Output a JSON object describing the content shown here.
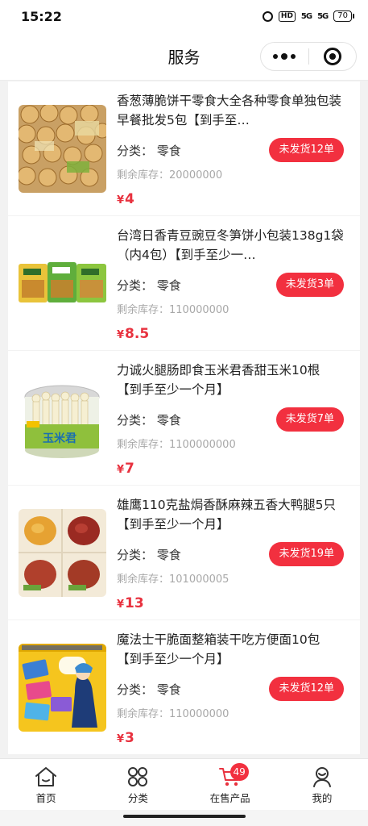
{
  "status_bar": {
    "time": "15:22",
    "hd": "HD",
    "sig1": "5G",
    "sig2": "5G",
    "battery": "70"
  },
  "nav": {
    "title": "服务"
  },
  "products": [
    {
      "title": "香葱薄脆饼干零食大全各种零食单独包装早餐批发5包【到手至…",
      "category": "分类：  零食",
      "stock": "剩余库存：20000000",
      "currency": "¥",
      "price": "4",
      "badge": "未发货12单"
    },
    {
      "title": "台湾日香青豆豌豆冬笋饼小包装138g1袋（内4包）【到手至少一…",
      "category": "分类：  零食",
      "stock": "剩余库存：110000000",
      "currency": "¥",
      "price": "8.5",
      "badge": "未发货3单"
    },
    {
      "title": "力诚火腿肠即食玉米君香甜玉米10根【到手至少一个月】",
      "category": "分类：  零食",
      "stock": "剩余库存：1100000000",
      "currency": "¥",
      "price": "7",
      "badge": "未发货7单"
    },
    {
      "title": "雄鹰110克盐焗香酥麻辣五香大鸭腿5只【到手至少一个月】",
      "category": "分类：  零食",
      "stock": "剩余库存：101000005",
      "currency": "¥",
      "price": "13",
      "badge": "未发货19单"
    },
    {
      "title": "魔法士干脆面整箱装干吃方便面10包【到手至少一个月】",
      "category": "分类：  零食",
      "stock": "剩余库存：110000000",
      "currency": "¥",
      "price": "3",
      "badge": "未发货12单"
    }
  ],
  "product_image_text": {
    "corn_brand": "玉米君"
  },
  "tabbar": {
    "tabs": [
      {
        "label": "首页",
        "icon": "home-icon"
      },
      {
        "label": "分类",
        "icon": "grid-icon"
      },
      {
        "label": "在售产品",
        "icon": "cart-icon",
        "badge": "49"
      },
      {
        "label": "我的",
        "icon": "user-icon"
      }
    ]
  },
  "colors": {
    "accent": "#f2303f",
    "price": "#e8323f",
    "muted": "#a8a8a8"
  }
}
